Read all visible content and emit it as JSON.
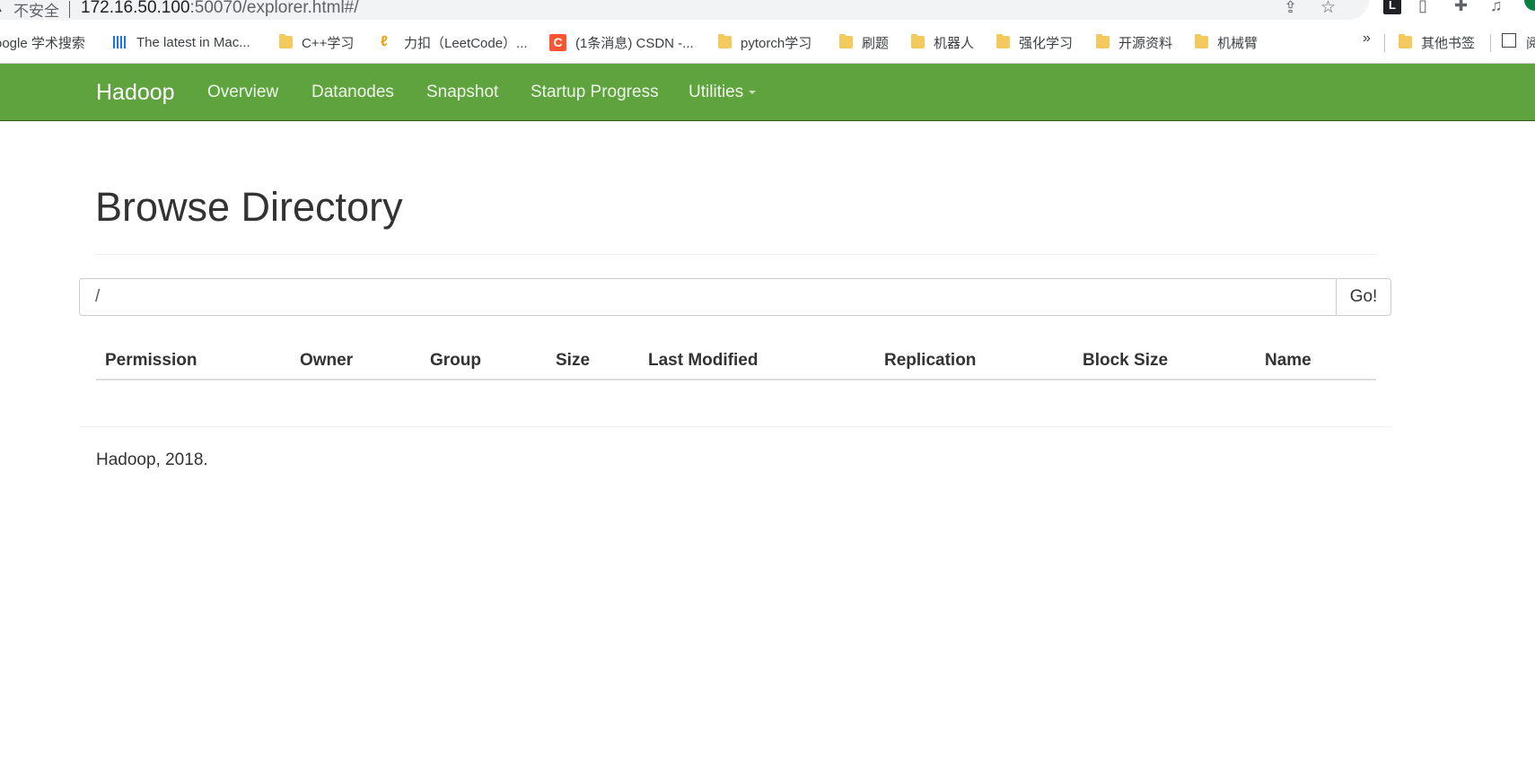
{
  "browser": {
    "insecure_label": "不安全",
    "url_host": "172.16.50.100",
    "url_port_path": ":50070/explorer.html#/",
    "bookmarks": [
      {
        "label": "oogle 学术搜索",
        "icon": "none"
      },
      {
        "label": "The latest in Mac...",
        "icon": "barcode-icon"
      },
      {
        "label": "C++学习",
        "icon": "folder-icon"
      },
      {
        "label": "力扣（LeetCode）...",
        "icon": "leetcode-icon"
      },
      {
        "label": "(1条消息) CSDN -...",
        "icon": "csdn-icon"
      },
      {
        "label": "pytorch学习",
        "icon": "folder-icon"
      },
      {
        "label": "刷题",
        "icon": "folder-icon"
      },
      {
        "label": "机器人",
        "icon": "folder-icon"
      },
      {
        "label": "强化学习",
        "icon": "folder-icon"
      },
      {
        "label": "开源资料",
        "icon": "folder-icon"
      },
      {
        "label": "机械臂",
        "icon": "folder-icon"
      }
    ],
    "more_label": "»",
    "other_bookmarks": "其他书签",
    "reading_list_partial": "阅"
  },
  "navbar": {
    "brand": "Hadoop",
    "items": [
      {
        "label": "Overview"
      },
      {
        "label": "Datanodes"
      },
      {
        "label": "Snapshot"
      },
      {
        "label": "Startup Progress"
      },
      {
        "label": "Utilities"
      }
    ],
    "color": "#5fa33e"
  },
  "main": {
    "title": "Browse Directory",
    "path_value": "/",
    "go_label": "Go!",
    "columns": [
      "Permission",
      "Owner",
      "Group",
      "Size",
      "Last Modified",
      "Replication",
      "Block Size",
      "Name"
    ],
    "rows": []
  },
  "footer": {
    "text": "Hadoop, 2018."
  }
}
